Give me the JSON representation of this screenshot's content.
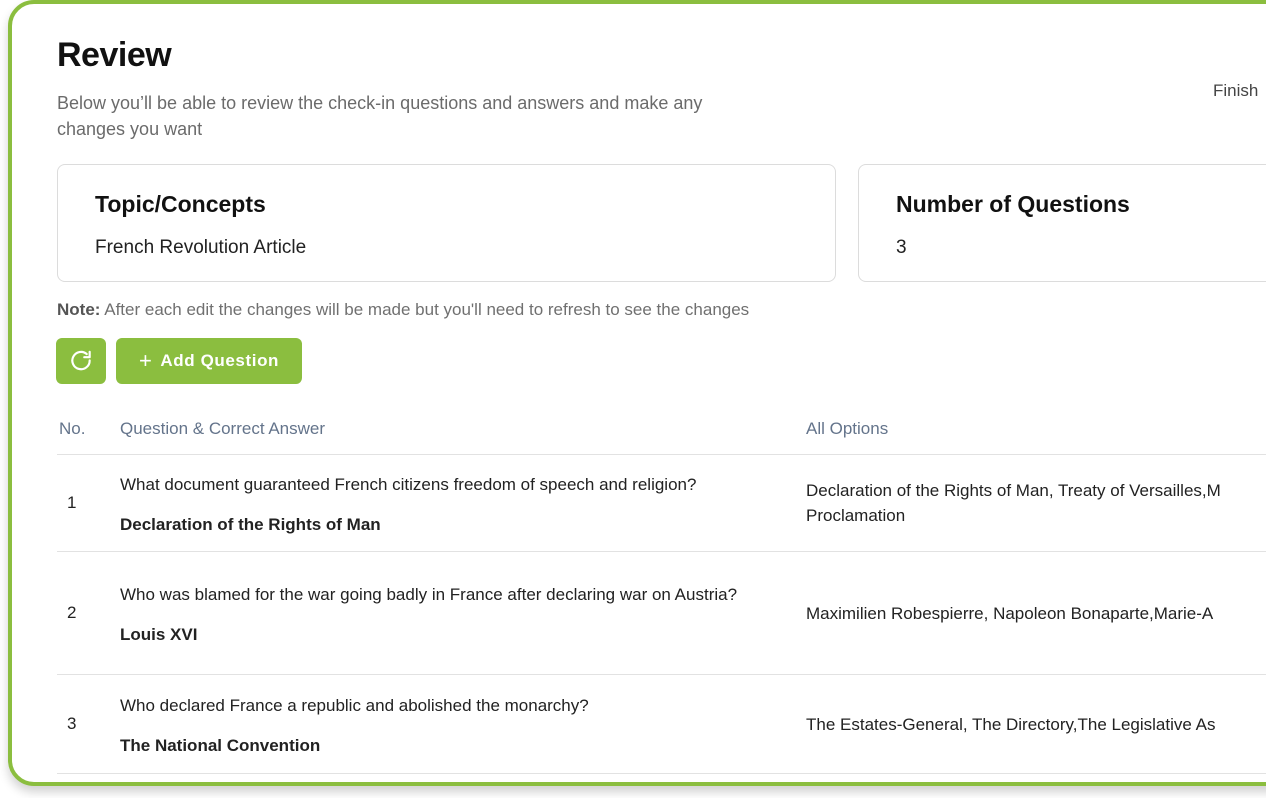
{
  "header": {
    "title": "Review",
    "subtitle": "Below you’ll be able to review the check-in questions and answers and make any changes you want",
    "finish_label": "Finish"
  },
  "cards": {
    "topic_label": "Topic/Concepts",
    "topic_value": "French Revolution Article",
    "count_label": "Number of Questions",
    "count_value": "3"
  },
  "note": {
    "prefix": "Note:",
    "text": "After each edit the changes will be made but you'll need to refresh to see the changes"
  },
  "toolbar": {
    "refresh_icon": "refresh-icon",
    "add_label": "Add Question",
    "add_icon": "+"
  },
  "table": {
    "headers": [
      "No.",
      "Question & Correct Answer",
      "All Options"
    ],
    "rows": [
      {
        "no": "1",
        "question": "What document guaranteed French citizens freedom of speech and religion?",
        "answer": "Declaration of the Rights of Man",
        "options": "Declaration of the Rights of Man, Treaty of Versailles,M Proclamation"
      },
      {
        "no": "2",
        "question": "Who was blamed for the war going badly in France after declaring war on Austria?",
        "answer": "Louis XVI",
        "options": "Maximilien Robespierre, Napoleon Bonaparte,Marie-A"
      },
      {
        "no": "3",
        "question": "Who declared France a republic and abolished the monarchy?",
        "answer": "The National Convention",
        "options": "The Estates-General, The Directory,The Legislative As"
      }
    ]
  },
  "colors": {
    "accent": "#8bbe3f",
    "header_text": "#64748b"
  }
}
